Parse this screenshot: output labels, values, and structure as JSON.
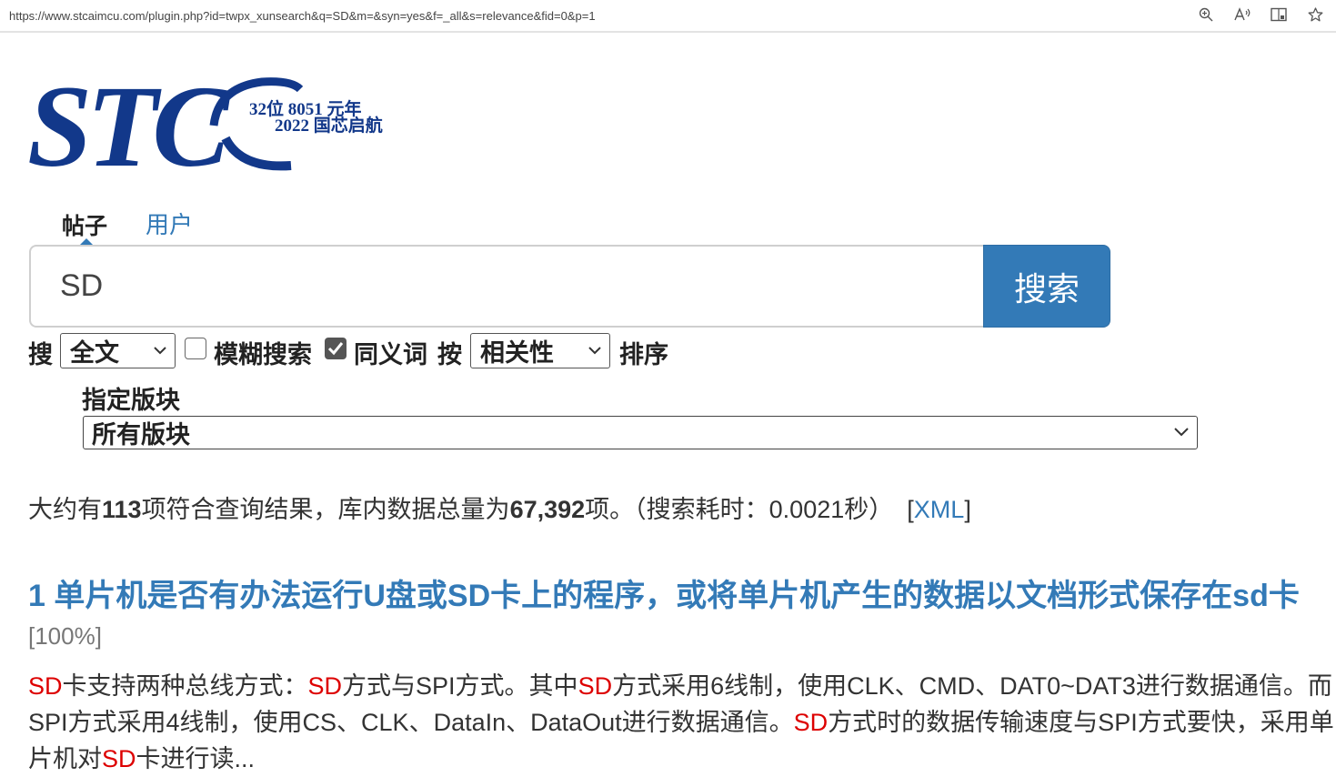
{
  "browser": {
    "url": "https://www.stcaimcu.com/plugin.php?id=twpx_xunsearch&q=SD&m=&syn=yes&f=_all&s=relevance&fid=0&p=1",
    "icons": [
      "zoom-icon",
      "read-aloud-icon",
      "reading-view-icon",
      "favorite-star-icon"
    ]
  },
  "logo": {
    "letters": "STC",
    "line1": "32位 8051 元年",
    "line2": "2022 国芯启航",
    "color": "#12388a"
  },
  "tabs": [
    {
      "label": "帖子",
      "active": true
    },
    {
      "label": "用户",
      "active": false
    }
  ],
  "search": {
    "value": "SD",
    "button_label": "搜索"
  },
  "options": {
    "search_label": "搜",
    "scope_selected": "全文",
    "fuzzy_label": "模糊搜索",
    "fuzzy_checked": false,
    "synonym_label": "同义词",
    "synonym_checked": true,
    "by_label": "按",
    "sort_selected": "相关性",
    "sort_label": "排序"
  },
  "forum": {
    "label": "指定版块",
    "selected": "所有版块"
  },
  "summary": {
    "prefix": "大约有",
    "count": "113",
    "middle": "项符合查询结果，库内数据总量为",
    "total": "67,392",
    "suffix": "项。（搜索耗时：0.0021秒）",
    "xml_open": "[",
    "xml_label": "XML",
    "xml_close": "]"
  },
  "results": [
    {
      "index": "1",
      "title": "单片机是否有办法运行U盘或SD卡上的程序，或将单片机产生的数据以文档形式保存在sd卡",
      "relevance": "[100%]",
      "snippet": [
        {
          "t": "SD",
          "hl": true
        },
        {
          "t": "卡支持两种总线方式：",
          "hl": false
        },
        {
          "t": "SD",
          "hl": true
        },
        {
          "t": "方式与SPI方式。其中",
          "hl": false
        },
        {
          "t": "SD",
          "hl": true
        },
        {
          "t": "方式采用6线制，使用CLK、CMD、DAT0~DAT3进行数据通信。而SPI方式采用4线制，使用CS、CLK、DataIn、DataOut进行数据通信。",
          "hl": false
        },
        {
          "t": "SD",
          "hl": true
        },
        {
          "t": "方式时的数据传输速度与SPI方式要快，采用单片机对",
          "hl": false
        },
        {
          "t": "SD",
          "hl": true
        },
        {
          "t": "卡进行读...",
          "hl": false
        }
      ]
    }
  ],
  "colors": {
    "link": "#337ab7",
    "highlight": "#dd0000"
  }
}
